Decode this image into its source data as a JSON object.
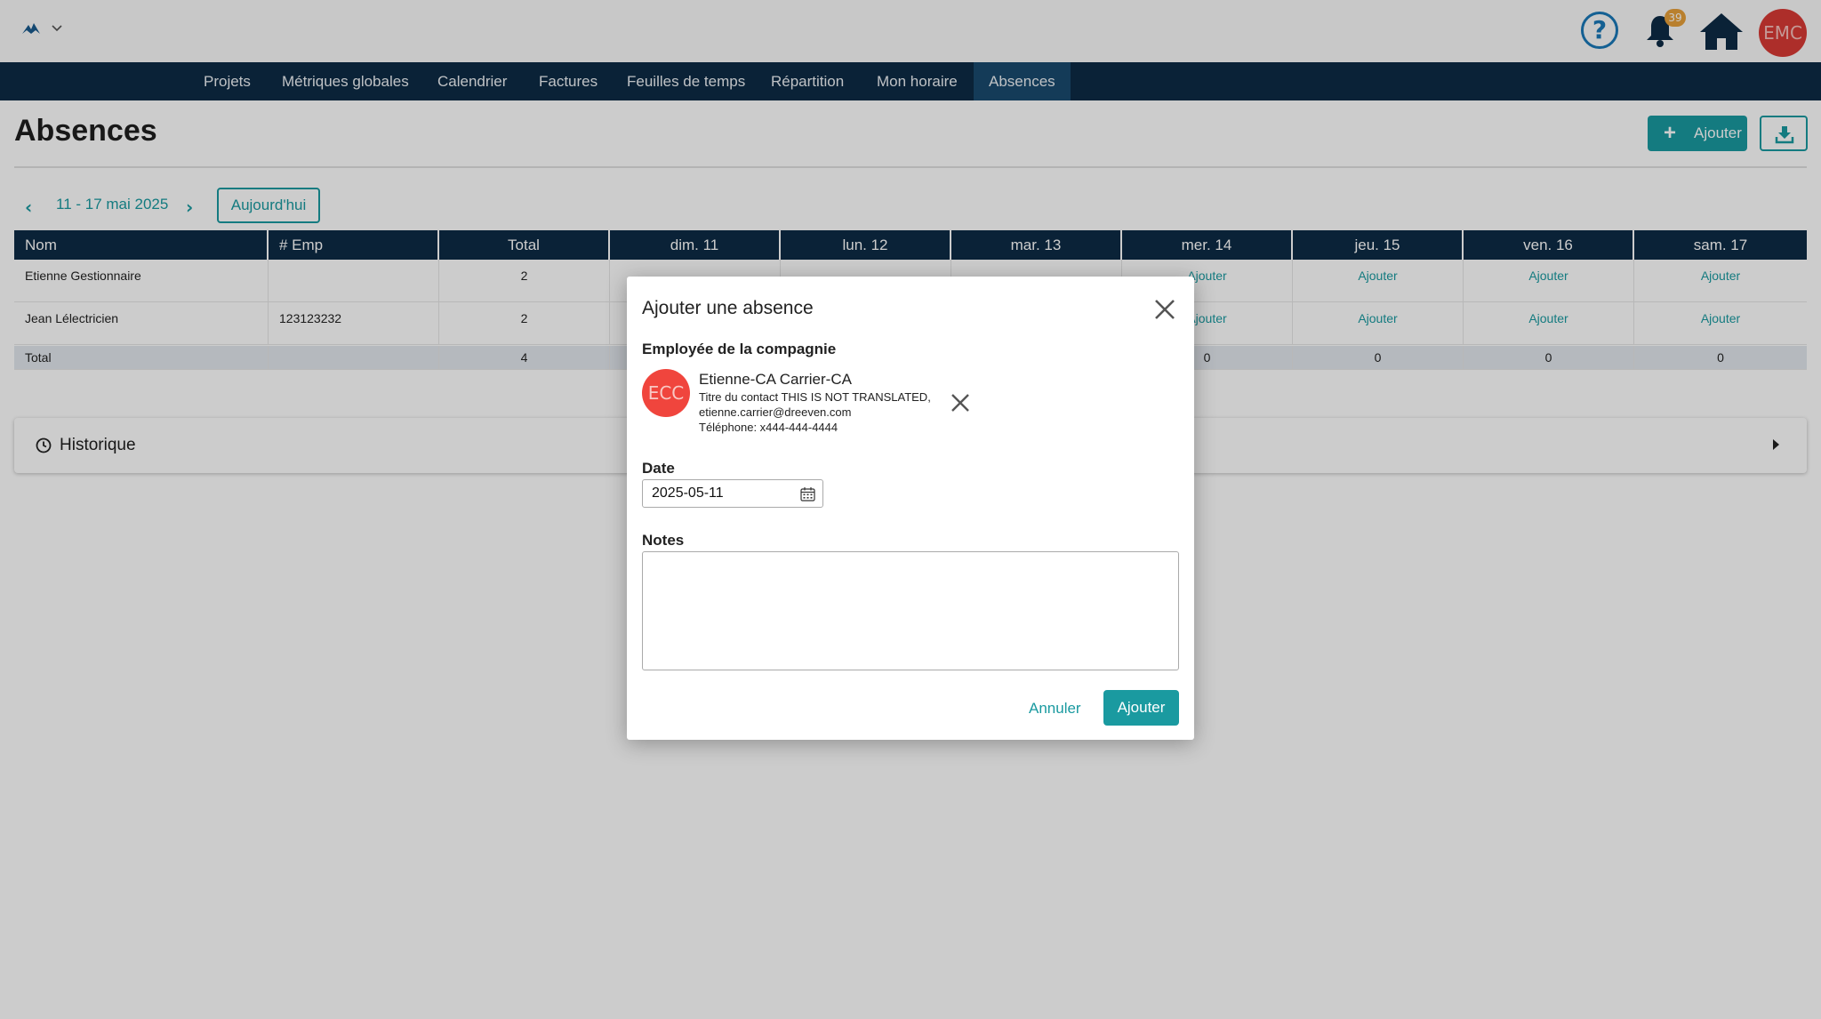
{
  "header": {
    "help_symbol": "?",
    "notification_count": "39",
    "user_initials": "EMC"
  },
  "nav": {
    "items": [
      "Projets",
      "Métriques globales",
      "Calendrier",
      "Factures",
      "Feuilles de temps",
      "Répartition",
      "Mon horaire",
      "Absences"
    ],
    "active": "Absences"
  },
  "page": {
    "title": "Absences",
    "add_label": "Ajouter"
  },
  "week": {
    "range": "11 - 17 mai 2025",
    "today_label": "Aujourd'hui"
  },
  "table": {
    "headers": [
      "Nom",
      "# Emp",
      "Total",
      "dim. 11",
      "lun. 12",
      "mar. 13",
      "mer. 14",
      "jeu. 15",
      "ven. 16",
      "sam. 17"
    ],
    "rows": [
      {
        "name": "Etienne Gestionnaire",
        "emp": "",
        "total": "2",
        "days": [
          "",
          "",
          "",
          "Ajouter",
          "Ajouter",
          "Ajouter",
          "Ajouter"
        ]
      },
      {
        "name": "Jean Lélectricien",
        "emp": "123123232",
        "total": "2",
        "days": [
          "",
          "",
          "",
          "Ajouter",
          "Ajouter",
          "Ajouter",
          "Ajouter"
        ]
      }
    ],
    "total_row": {
      "label": "Total",
      "total": "4",
      "days": [
        "",
        "",
        "",
        "0",
        "0",
        "0",
        "0"
      ]
    }
  },
  "history": {
    "label": "Historique"
  },
  "modal": {
    "title": "Ajouter une absence",
    "employee_label": "Employée de la compagnie",
    "employee": {
      "initials": "ECC",
      "name": "Etienne-CA Carrier-CA",
      "title": "Titre du contact THIS IS NOT TRANSLATED,",
      "email": "etienne.carrier@dreeven.com",
      "phone": "Téléphone: x444-444-4444"
    },
    "date_label": "Date",
    "date_value": "2025-05-11",
    "notes_label": "Notes",
    "notes_value": "",
    "cancel_label": "Annuler",
    "submit_label": "Ajouter"
  },
  "colors": {
    "navy": "#0d2b45",
    "teal": "#1a9aa0",
    "red": "#d9302c"
  }
}
